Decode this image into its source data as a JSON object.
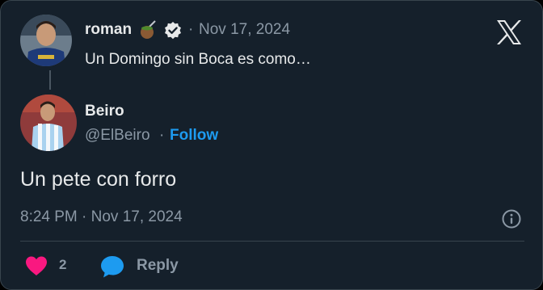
{
  "parent_tweet": {
    "author_name": "roman",
    "date_separator": "·",
    "date": "Nov 17, 2024",
    "text": "Un Domingo sin Boca es como…",
    "icons": [
      "mate-icon",
      "verified-icon"
    ]
  },
  "reply_tweet": {
    "author_name": "Beiro",
    "handle": "@ElBeiro",
    "handle_separator": "·",
    "follow_label": "Follow",
    "text": "Un pete con forro",
    "timestamp": "8:24 PM · Nov 17, 2024"
  },
  "actions": {
    "like_count": "2",
    "reply_label": "Reply"
  },
  "brand": {
    "logo": "x-logo-icon"
  },
  "colors": {
    "background": "#15202b",
    "border": "#38444d",
    "text_primary": "#e7e9ea",
    "text_secondary": "#8b98a5",
    "link": "#1d9bf0",
    "heart": "#f91880",
    "reply_bubble": "#1d9bf0"
  }
}
